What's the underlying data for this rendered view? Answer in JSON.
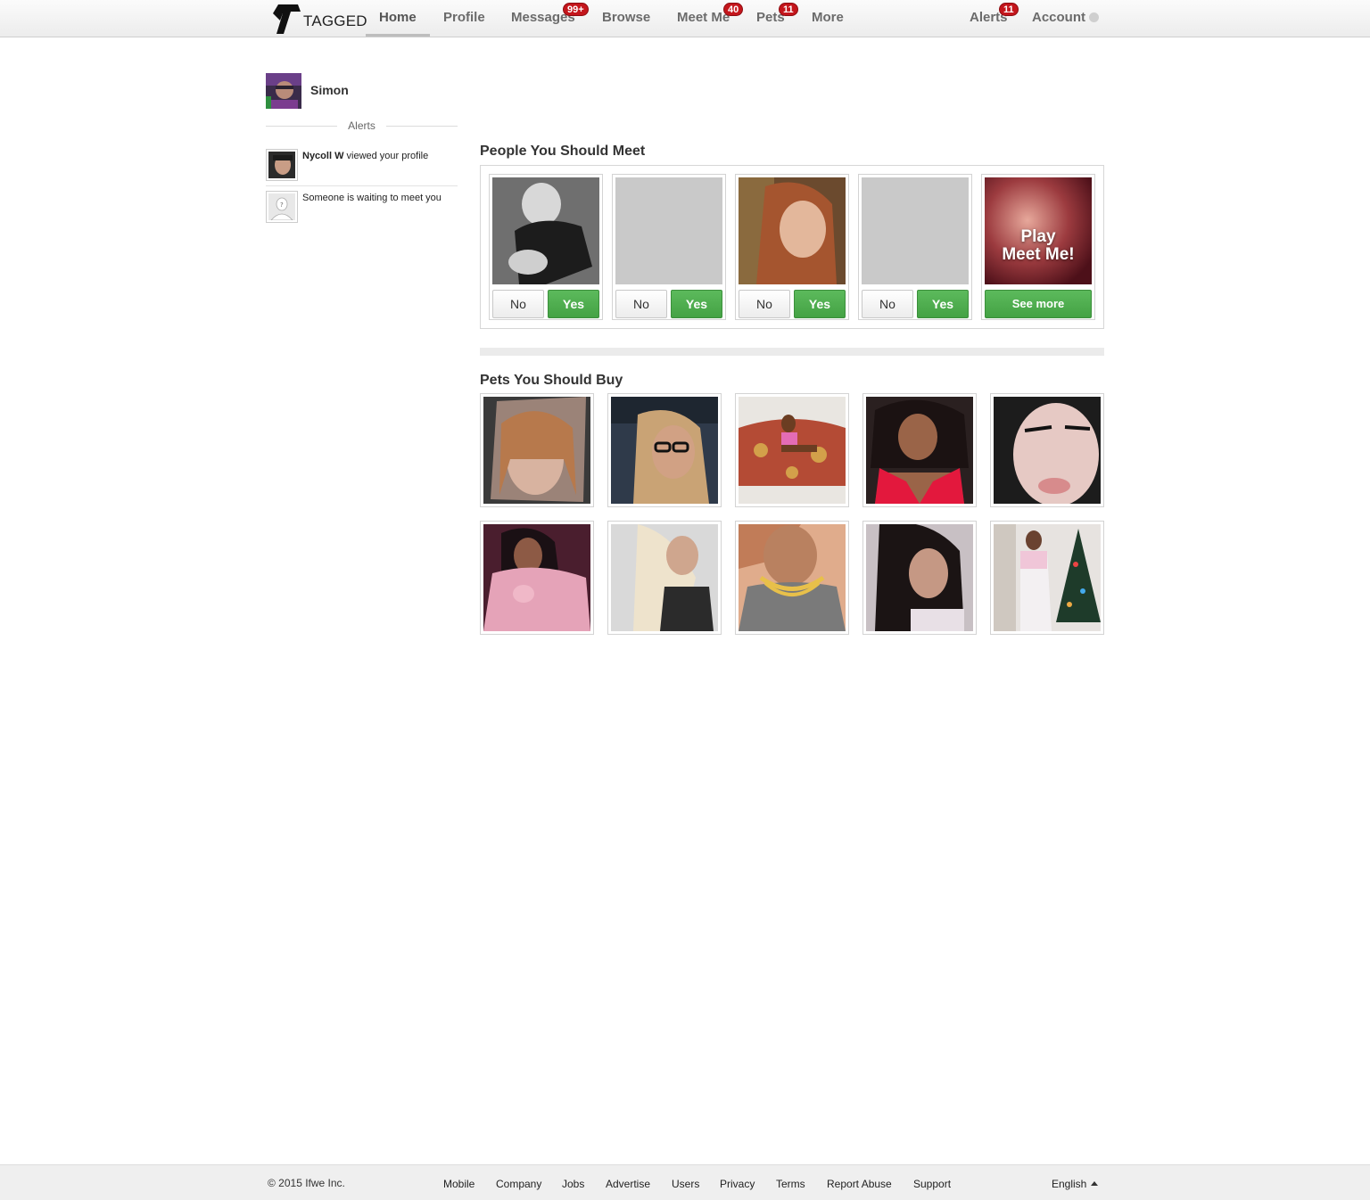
{
  "brand": {
    "logo_text": "TAGGED"
  },
  "nav": {
    "home": "Home",
    "profile": "Profile",
    "messages": "Messages",
    "messages_badge": "99+",
    "browse": "Browse",
    "meetme": "Meet Me",
    "meetme_badge": "40",
    "pets": "Pets",
    "pets_badge": "11",
    "more": "More",
    "alerts": "Alerts",
    "alerts_badge": "11",
    "account": "Account"
  },
  "sidebar": {
    "user_name": "Simon",
    "alerts_heading": "Alerts",
    "alerts": [
      {
        "actor": "Nycoll W",
        "text": " viewed your profile"
      },
      {
        "actor": "",
        "text": "Someone is waiting to meet you"
      }
    ]
  },
  "meet": {
    "title": "People You Should Meet",
    "no_label": "No",
    "yes_label": "Yes",
    "play_line1": "Play",
    "play_line2": "Meet Me!",
    "see_more_label": "See more"
  },
  "pets": {
    "title": "Pets You Should Buy"
  },
  "footer": {
    "copyright": "© 2015 Ifwe Inc.",
    "links": [
      "Mobile",
      "Company",
      "Jobs",
      "Advertise",
      "Users",
      "Privacy",
      "Terms",
      "Report Abuse",
      "Support"
    ],
    "language": "English"
  },
  "colors": {
    "badge": "#c4161c",
    "yes_green": "#4cae4c",
    "nav_text": "#6b6b6b"
  }
}
